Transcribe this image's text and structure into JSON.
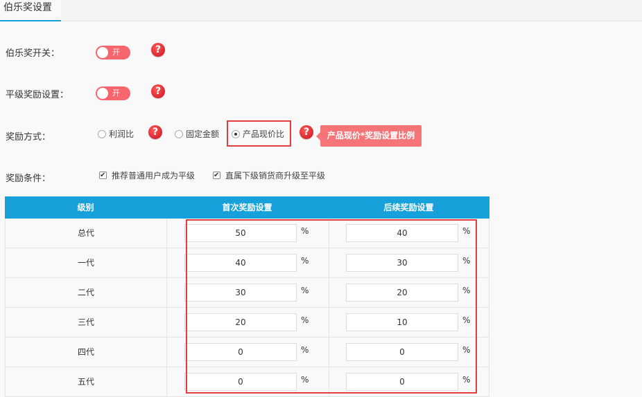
{
  "tab": {
    "label": "伯乐奖设置"
  },
  "rows": {
    "switch_label": "伯乐奖开关：",
    "switch_state": "开",
    "level_label": "平级奖励设置：",
    "level_state": "开",
    "method_label": "奖励方式：",
    "method_options": [
      "利润比",
      "固定金额",
      "产品现价比"
    ],
    "condition_label": "奖励条件：",
    "condition_options": [
      "推荐普通用户成为平级",
      "直属下级销货商升级至平级"
    ]
  },
  "help_icon": "?",
  "tooltip": "产品现价*奖励设置比例",
  "table": {
    "headers": [
      "级别",
      "首次奖励设置",
      "后续奖励设置"
    ],
    "unit": "%",
    "rows": [
      {
        "level": "总代",
        "first": "50",
        "next": "40"
      },
      {
        "level": "一代",
        "first": "40",
        "next": "30"
      },
      {
        "level": "二代",
        "first": "30",
        "next": "20"
      },
      {
        "level": "三代",
        "first": "20",
        "next": "10"
      },
      {
        "level": "四代",
        "first": "0",
        "next": "0"
      },
      {
        "level": "五代",
        "first": "0",
        "next": "0"
      }
    ]
  }
}
